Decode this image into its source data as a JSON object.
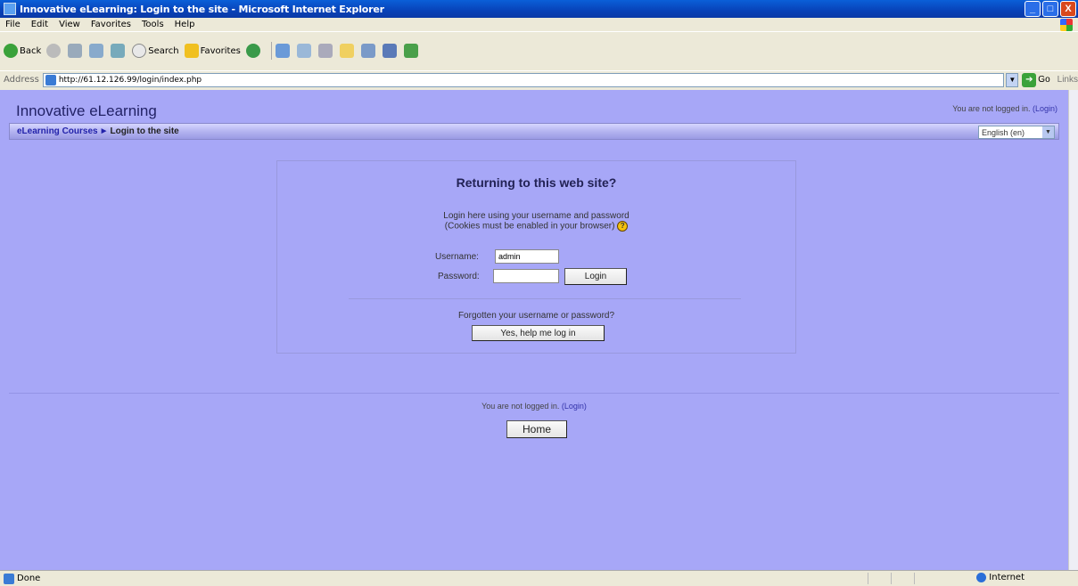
{
  "window": {
    "title": "Innovative eLearning: Login to the site - Microsoft Internet Explorer",
    "buttons": [
      "_",
      "□",
      "X"
    ]
  },
  "menu": [
    "File",
    "Edit",
    "View",
    "Favorites",
    "Tools",
    "Help"
  ],
  "toolbar": {
    "back_label": "Back",
    "search_label": "Search",
    "favorites_label": "Favorites"
  },
  "address": {
    "label": "Address",
    "url": "http://61.12.126.99/login/index.php",
    "go_label": "Go",
    "links_label": "Links"
  },
  "page": {
    "site_title": "Innovative eLearning",
    "login_status_text": "You are not logged in.",
    "login_link": "(Login)",
    "breadcrumb": {
      "parent": "eLearning Courses",
      "separator": "►",
      "current": "Login to the site"
    },
    "language": "English (en)",
    "login_box": {
      "heading": "Returning to this web site?",
      "desc_line1": "Login here using your username and password",
      "desc_line2": "(Cookies must be enabled in your browser)",
      "username_label": "Username:",
      "username_value": "admin",
      "password_label": "Password:",
      "password_value": "",
      "login_button": "Login",
      "forgot_text": "Forgotten your username or password?",
      "help_button": "Yes, help me log in"
    },
    "footer": {
      "login_status_text": "You are not logged in.",
      "login_link": "(Login)",
      "home_button": "Home"
    }
  },
  "status": {
    "text": "Done",
    "zone": "Internet"
  },
  "colors": {
    "page_background": "#a7a7f7",
    "titlebar": "#0842b8",
    "heading_text": "#222255",
    "link": "#3333aa"
  }
}
